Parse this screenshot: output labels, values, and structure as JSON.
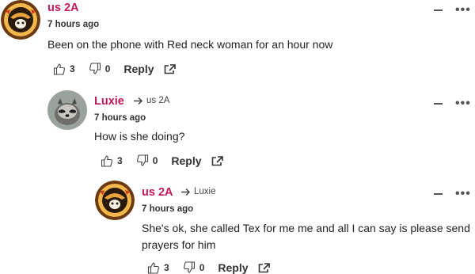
{
  "comments": [
    {
      "author": "us 2A",
      "reply_to": "",
      "time": "7 hours ago",
      "text": "Been on the phone with Red neck woman for an hour now",
      "likes": "3",
      "dislikes": "0",
      "reply_label": "Reply",
      "avatar_icon": "cowboy-badge-avatar-icon"
    },
    {
      "author": "Luxie",
      "reply_to": "us 2A",
      "time": "7 hours ago",
      "text": "How is she doing?",
      "likes": "3",
      "dislikes": "0",
      "reply_label": "Reply",
      "avatar_icon": "raccoon-avatar-icon"
    },
    {
      "author": "us 2A",
      "reply_to": "Luxie",
      "time": "7 hours ago",
      "text": "She's ok, she called Tex for me me and all I can say is please send prayers for him",
      "likes": "3",
      "dislikes": "0",
      "reply_label": "Reply",
      "avatar_icon": "cowboy-badge-avatar-icon"
    }
  ],
  "colors": {
    "author": "#c2185b",
    "text": "#222222",
    "muted": "#555555"
  }
}
